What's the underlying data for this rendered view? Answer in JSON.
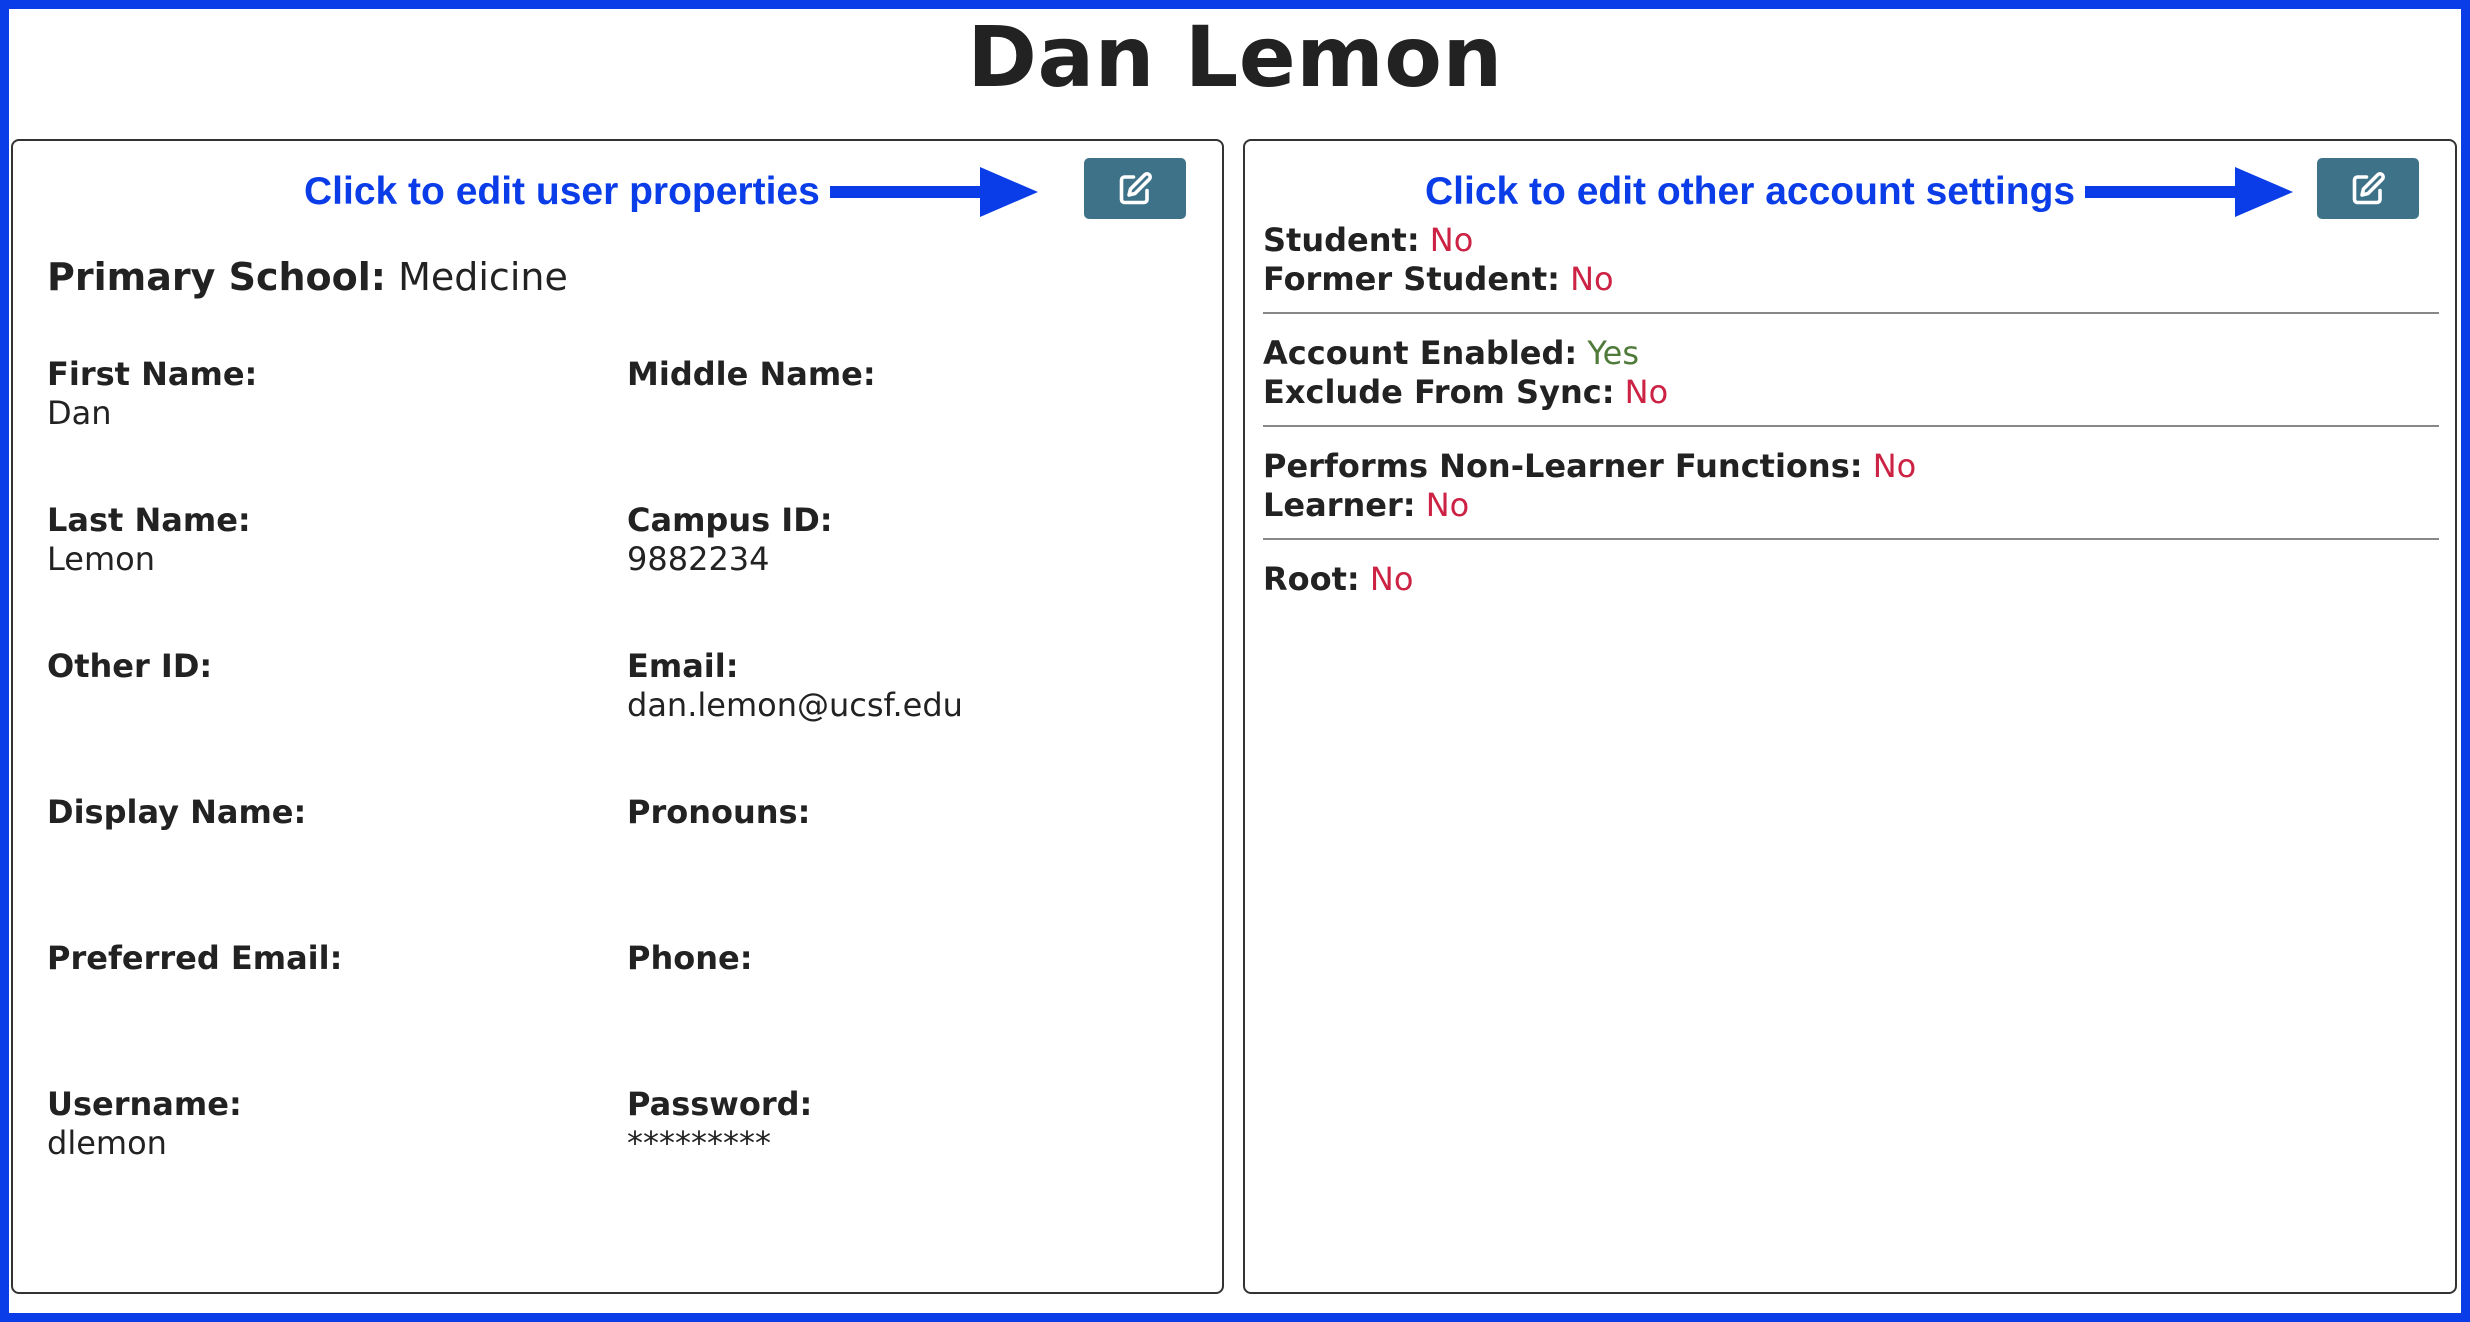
{
  "page": {
    "title": "Dan Lemon"
  },
  "user_panel": {
    "callout": "Click to edit user properties",
    "edit_icon": "edit-icon",
    "primary_school": {
      "label": "Primary School:",
      "value": "Medicine"
    },
    "fields": {
      "first_name": {
        "label": "First Name:",
        "value": "Dan"
      },
      "middle_name": {
        "label": "Middle Name:",
        "value": ""
      },
      "last_name": {
        "label": "Last Name:",
        "value": "Lemon"
      },
      "campus_id": {
        "label": "Campus ID:",
        "value": "9882234"
      },
      "other_id": {
        "label": "Other ID:",
        "value": ""
      },
      "email": {
        "label": "Email:",
        "value": "dan.lemon@ucsf.edu"
      },
      "display_name": {
        "label": "Display Name:",
        "value": ""
      },
      "pronouns": {
        "label": "Pronouns:",
        "value": ""
      },
      "preferred_email": {
        "label": "Preferred Email:",
        "value": ""
      },
      "phone": {
        "label": "Phone:",
        "value": ""
      },
      "username": {
        "label": "Username:",
        "value": "dlemon"
      },
      "password": {
        "label": "Password:",
        "value": "*********"
      }
    }
  },
  "settings_panel": {
    "callout": "Click to edit other account settings",
    "edit_icon": "edit-icon",
    "student": {
      "label": "Student:",
      "value": "No"
    },
    "former_student": {
      "label": "Former Student:",
      "value": "No"
    },
    "account_enabled": {
      "label": "Account Enabled:",
      "value": "Yes"
    },
    "exclude_from_sync": {
      "label": "Exclude From Sync:",
      "value": "No"
    },
    "performs_non_learner": {
      "label": "Performs Non-Learner Functions:",
      "value": "No"
    },
    "learner": {
      "label": "Learner:",
      "value": "No"
    },
    "root": {
      "label": "Root:",
      "value": "No"
    }
  },
  "colors": {
    "annotation_blue": "#0a3de8",
    "button_bg": "#3d7289",
    "no_red": "#cc2244",
    "yes_green": "#4f7a3a"
  }
}
